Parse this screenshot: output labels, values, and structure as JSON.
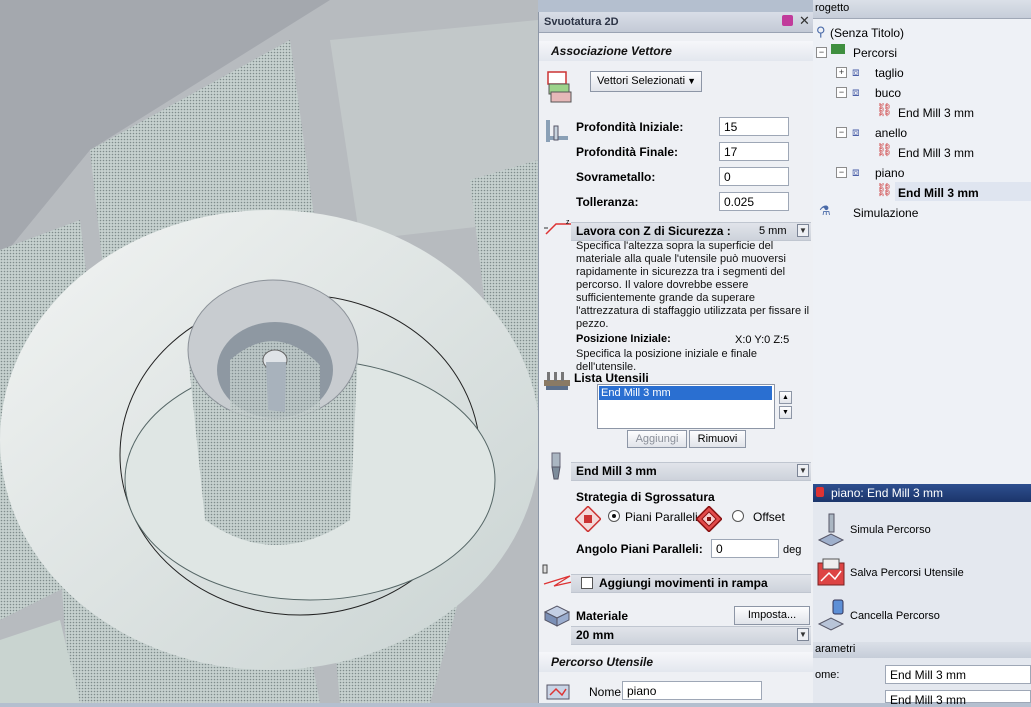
{
  "panel": {
    "title": "Svuotatura 2D",
    "vector_section": {
      "title": "Associazione Vettore",
      "dropdown": "Vettori Selezionati"
    },
    "fields": [
      {
        "label": "Profondità Iniziale:",
        "value": "15"
      },
      {
        "label": "Profondità Finale:",
        "value": "17"
      },
      {
        "label": "Sovrametallo:",
        "value": "0"
      },
      {
        "label": "Tolleranza:",
        "value": "0.025"
      }
    ],
    "safe_z": {
      "label": "Lavora con Z di Sicurezza :",
      "value": "5 mm",
      "description": "Specifica l'altezza sopra la superficie del materiale alla quale l'utensile può muoversi rapidamente in sicurezza tra i segmenti del percorso. Il valore dovrebbe essere sufficientemente grande da superare l'attrezzatura di staffaggio utilizzata per fissare il pezzo.",
      "home_label": "Posizione Iniziale:",
      "home_value": "X:0 Y:0 Z:5",
      "home_description": "Specifica la posizione iniziale e finale dell'utensile."
    },
    "tool_list": {
      "title": "Lista Utensili",
      "items": [
        "End Mill 3 mm"
      ],
      "add_label": "Aggiungi",
      "remove_label": "Rimuovi"
    },
    "tool_select": "End Mill 3 mm",
    "strategy": {
      "title": "Strategia di Sgrossatura",
      "option1": "Piani Paralleli",
      "option2": "Offset",
      "angle_label": "Angolo Piani Paralleli:",
      "angle_value": "0",
      "angle_unit": "deg"
    },
    "ramp_label": "Aggiungi movimenti in rampa",
    "material": {
      "label": "Materiale",
      "button": "Imposta...",
      "value": "20 mm"
    },
    "toolpath_section": {
      "title": "Percorso Utensile",
      "name_label": "Nome:",
      "name_value": "piano"
    }
  },
  "tree": {
    "header": "rogetto",
    "root": "(Senza Titolo)",
    "paths": "Percorsi",
    "items": [
      {
        "name": "taglio",
        "child": ""
      },
      {
        "name": "buco",
        "child": "End Mill 3 mm"
      },
      {
        "name": "anello",
        "child": "End Mill 3 mm"
      },
      {
        "name": "piano",
        "child": "End Mill 3 mm"
      }
    ],
    "simulation": "Simulazione"
  },
  "ops": {
    "bar_title": "piano: End Mill 3 mm",
    "simulate": "Simula Percorso",
    "save": "Salva Percorsi Utensile",
    "delete": "Cancella Percorso",
    "params_header": "arametri",
    "name_label": "ome:",
    "name_value": "End Mill 3 mm",
    "name_value2": "End Mill 3 mm"
  },
  "colors": {
    "accent": "#1b356b",
    "selection": "#2a6fd1",
    "panel": "#eef0f4"
  }
}
